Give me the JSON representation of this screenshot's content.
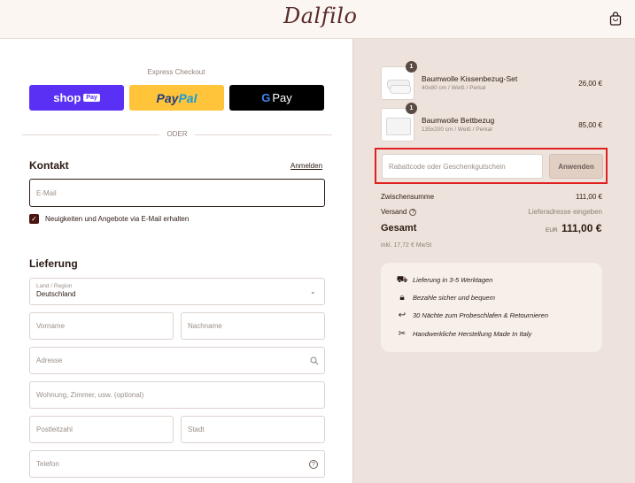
{
  "header": {
    "logo": "Dalfilo",
    "cart_icon": "shopping-bag-icon"
  },
  "express": {
    "label": "Express Checkout",
    "shop_pay": {
      "text": "shop",
      "chip": "Pay"
    },
    "paypal": {
      "pay": "Pay",
      "pal": "Pal"
    },
    "gpay": {
      "g": "G",
      "text": "Pay"
    },
    "divider": "ODER"
  },
  "contact": {
    "title": "Kontakt",
    "login": "Anmelden",
    "email_placeholder": "E-Mail",
    "newsletter": "Neuigkeiten und Angebote via E-Mail erhalten",
    "newsletter_checked": true
  },
  "delivery": {
    "title": "Lieferung",
    "country_label": "Land / Region",
    "country_value": "Deutschland",
    "first_name": "Vorname",
    "last_name": "Nachname",
    "address": "Adresse",
    "address2": "Wohnung, Zimmer, usw. (optional)",
    "zip": "Postleitzahl",
    "city": "Stadt",
    "phone": "Telefon"
  },
  "cart": {
    "items": [
      {
        "qty": "1",
        "name": "Baumwolle Kissenbezug-Set",
        "variant": "40x80 cm / Weiß / Perkal",
        "price": "26,00 €"
      },
      {
        "qty": "1",
        "name": "Baumwolle Bettbezug",
        "variant": "135x200 cm / Weiß / Perkal",
        "price": "85,00 €"
      }
    ],
    "discount_placeholder": "Rabattcode oder Geschenkgutschein",
    "apply": "Anwenden",
    "subtotal_label": "Zwischensumme",
    "subtotal_value": "111,00 €",
    "shipping_label": "Versand",
    "shipping_value": "Lieferadresse eingeben",
    "total_label": "Gesamt",
    "currency": "EUR",
    "total_value": "111,00 €",
    "tax_note": "inkl. 17,72 € MwSt"
  },
  "benefits": [
    {
      "icon": "truck-icon",
      "text": "Lieferung in 3-5 Werktagen"
    },
    {
      "icon": "lock-icon",
      "text": "Bezahle sicher und bequem"
    },
    {
      "icon": "return-arrow-icon",
      "text": "30 Nächte zum Probeschlafen & Retournieren"
    },
    {
      "icon": "sewing-machine-icon",
      "text": "Handwerkliche Herstellung Made In Italy"
    }
  ]
}
